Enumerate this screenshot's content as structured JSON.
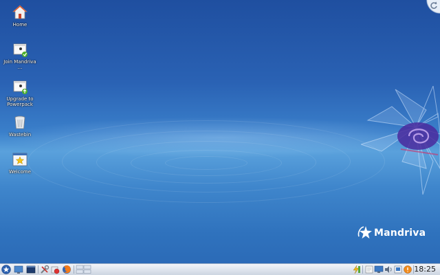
{
  "desktop": {
    "icons": [
      {
        "label": "Home",
        "icon": "home-folder-icon"
      },
      {
        "label": "Join Mandriva ...",
        "icon": "join-document-icon"
      },
      {
        "label": "Upgrade to Powerpack",
        "icon": "upgrade-document-icon"
      },
      {
        "label": "Wastebin",
        "icon": "trash-icon"
      },
      {
        "label": "Welcome",
        "icon": "welcome-star-icon"
      }
    ],
    "brand": {
      "name": "Mandriva",
      "color": "#ffffff"
    },
    "accent": "#2a62b4"
  },
  "taskbar": {
    "launchers": [
      "start-menu-icon",
      "show-desktop-icon",
      "terminal-icon",
      "system-settings-icon",
      "software-manager-icon",
      "firefox-icon",
      "pager-icon"
    ],
    "tray": [
      "network-icon",
      "notes-icon",
      "display-icon",
      "volume-icon",
      "clipboard-icon",
      "updates-icon"
    ],
    "clock": "18:25"
  }
}
